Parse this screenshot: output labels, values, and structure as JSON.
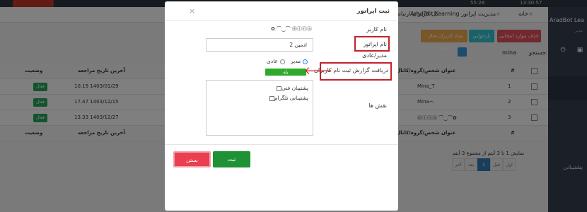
{
  "topbar": {
    "clock_left": "55:28",
    "clock_right": "13:30:57"
  },
  "tabs": [
    {
      "label": "خانه"
    },
    {
      "label": "مدیریت اپراتور AradBot Learning"
    },
    {
      "label": "کل کاربران ارتباط..."
    }
  ],
  "sidebar": {
    "brand": "AradBot Lea",
    "sub": "مدیر",
    "support_item": "پشتیبانی"
  },
  "toolbar": {
    "delete_label": "حذف موارد انتخابی",
    "refresh_label": "بازخوانی",
    "active_users_label": "تعداد کاربران فعال : 352"
  },
  "search": {
    "label": "جستجو:",
    "value": "mina"
  },
  "table": {
    "headers": {
      "num": "#",
      "title": "عنوان شخص/گروه/کانال",
      "last_date": "آخرین تاریخ مراجعه",
      "status": "وضعیت"
    },
    "rows": [
      {
        "num": "1",
        "title": "Mina_T",
        "date": "10.19 1403/01/29",
        "status": "فعال"
      },
      {
        "num": "2",
        "title": "Mina~.",
        "date": "17.47 1403/12/15",
        "status": "فعال"
      },
      {
        "num": "3",
        "title": "ⓜⓘⓝⓐ ⌒‿⌒✿",
        "date": "13.33 1403/12/27",
        "status": "فعال"
      }
    ]
  },
  "pagination": {
    "info": "نمایش 1 تا 3 آیتم از مجموع 3 آیتم",
    "first": "اول",
    "prev": "قبل",
    "current": "1",
    "next": "بعد",
    "last": "آخر"
  },
  "modal": {
    "title": "ثبت اپراتور",
    "close_icon": "×",
    "username_label": "نام کاربر",
    "username_value": "✿ ⌒‿⌒ ⓜⓘⓝⓐ",
    "operator_name_label": "نام اپراتور",
    "operator_name_value": "ادمین 2",
    "role_type_label": "مدیر/عادی",
    "radio_admin": "مدیر",
    "radio_normal": "عادی",
    "report_label": "دریافت گزارش ثبت نام کاربران",
    "report_yes": "بله",
    "roles_label": "نقش ها",
    "roles": [
      "پشتیبان فنی",
      "پشتیبانی تلگرام"
    ],
    "close_button": "بستن",
    "submit_button": "ثبت"
  },
  "colors": {
    "highlight": "#c5222b",
    "submit": "#1e9234",
    "close": "#ea3f4f",
    "yes": "#2fa92b"
  }
}
